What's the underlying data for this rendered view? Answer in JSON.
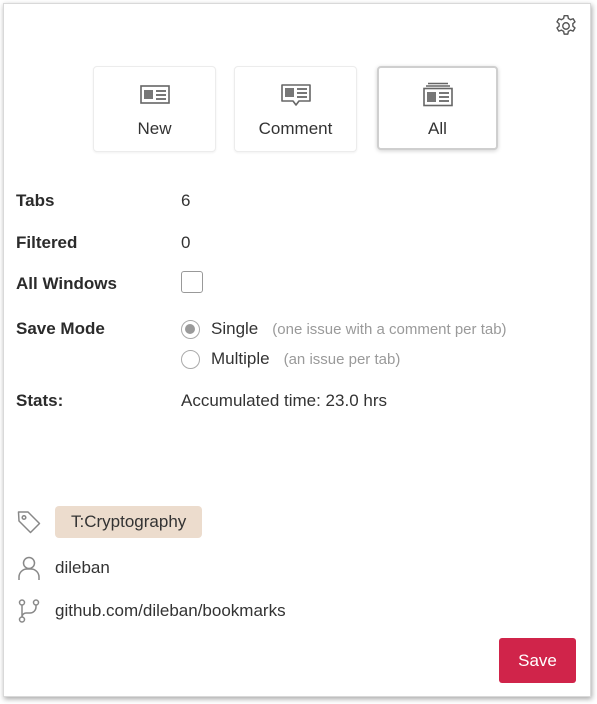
{
  "settings": {
    "icon": "gear-icon"
  },
  "modes": [
    {
      "label": "New",
      "icon": "new-issue-icon",
      "active": false
    },
    {
      "label": "Comment",
      "icon": "comment-icon",
      "active": false
    },
    {
      "label": "All",
      "icon": "all-tabs-icon",
      "active": true
    }
  ],
  "tabs": {
    "label": "Tabs",
    "value": "6"
  },
  "filtered": {
    "label": "Filtered",
    "value": "0"
  },
  "all_windows": {
    "label": "All Windows",
    "checked": false
  },
  "save_mode": {
    "label": "Save Mode",
    "options": [
      {
        "label": "Single",
        "hint": "(one issue with a comment per tab)",
        "checked": true
      },
      {
        "label": "Multiple",
        "hint": "(an issue per tab)",
        "checked": false
      }
    ]
  },
  "stats": {
    "label": "Stats:",
    "value": "Accumulated time: 23.0 hrs"
  },
  "tag": {
    "icon": "tag-icon",
    "label": "T:Cryptography"
  },
  "user": {
    "icon": "user-icon",
    "name": "dileban"
  },
  "repo": {
    "icon": "branch-icon",
    "path": "github.com/dileban/bookmarks"
  },
  "actions": {
    "save_label": "Save",
    "save_color": "#d0244a"
  }
}
